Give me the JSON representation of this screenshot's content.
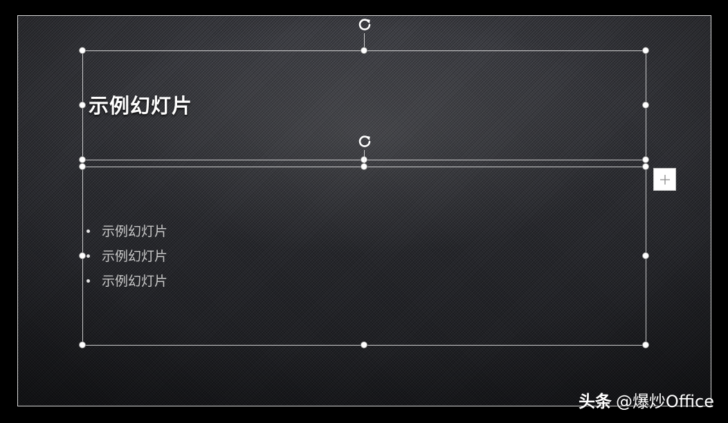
{
  "slide": {
    "title": "示例幻灯片",
    "bullets": [
      "示例幻灯片",
      "示例幻灯片",
      "示例幻灯片"
    ]
  },
  "icons": {
    "rotate": "rotate-icon",
    "add": "plus-icon",
    "handle": "resize-handle"
  },
  "watermark": {
    "brand": "头条",
    "account": "@爆炒Office"
  },
  "colors": {
    "background": "#2c2d32",
    "selection": "#ebebeb",
    "title_text": "#ffffff",
    "body_text": "#c9c9c9"
  }
}
